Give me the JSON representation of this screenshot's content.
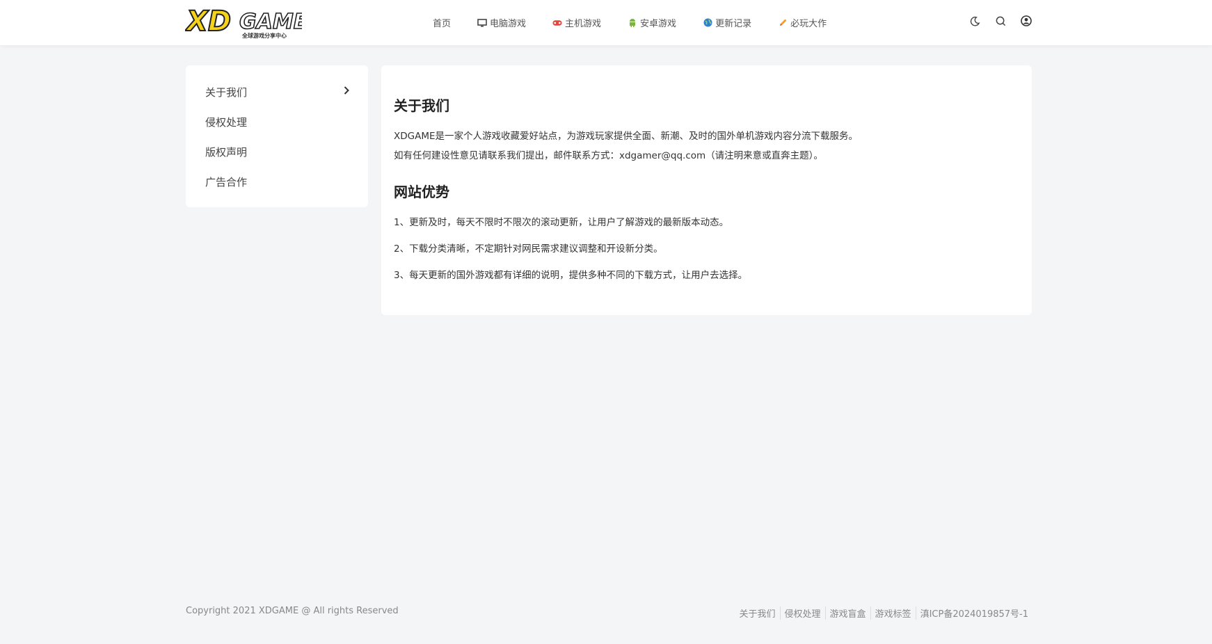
{
  "header": {
    "logo_text": "XD GAME",
    "logo_subtitle": "全球游戏分享中心",
    "nav": [
      {
        "label": "首页",
        "icon": "none"
      },
      {
        "label": "电脑游戏",
        "icon": "monitor-icon"
      },
      {
        "label": "主机游戏",
        "icon": "gamepad-icon"
      },
      {
        "label": "安卓游戏",
        "icon": "android-icon"
      },
      {
        "label": "更新记录",
        "icon": "globe-icon"
      },
      {
        "label": "必玩大作",
        "icon": "pencil-icon"
      }
    ],
    "tools": [
      "moon-icon",
      "search-icon",
      "user-icon"
    ]
  },
  "sidebar": {
    "items": [
      {
        "label": "关于我们",
        "active": true
      },
      {
        "label": "侵权处理"
      },
      {
        "label": "版权声明"
      },
      {
        "label": "广告合作"
      }
    ]
  },
  "content": {
    "about_title": "关于我们",
    "about_p1": "XDGAME是一家个人游戏收藏爱好站点，为游戏玩家提供全面、新潮、及时的国外单机游戏内容分流下载服务。",
    "about_p2": "如有任何建设性意见请联系我们提出，邮件联系方式：xdgamer@qq.com（请注明来意或直奔主题）。",
    "adv_title": "网站优势",
    "adv_items": [
      "1、更新及时，每天不限时不限次的滚动更新，让用户了解游戏的最新版本动态。",
      "2、下载分类清晰，不定期针对网民需求建议调整和开设新分类。",
      "3、每天更新的国外游戏都有详细的说明，提供多种不同的下载方式，让用户去选择。"
    ]
  },
  "footer": {
    "copyright": "Copyright 2021 XDGAME @ All rights Reserved",
    "links": [
      "关于我们",
      "侵权处理",
      "游戏盲盒",
      "游戏标签",
      "滇ICP备2024019857号-1"
    ]
  },
  "colors": {
    "logo_yellow": "#f5d31c",
    "accent_red": "#e0483e",
    "android_green": "#7cb342",
    "globe_blue": "#2f80d1",
    "pencil_orange": "#f0a030"
  }
}
